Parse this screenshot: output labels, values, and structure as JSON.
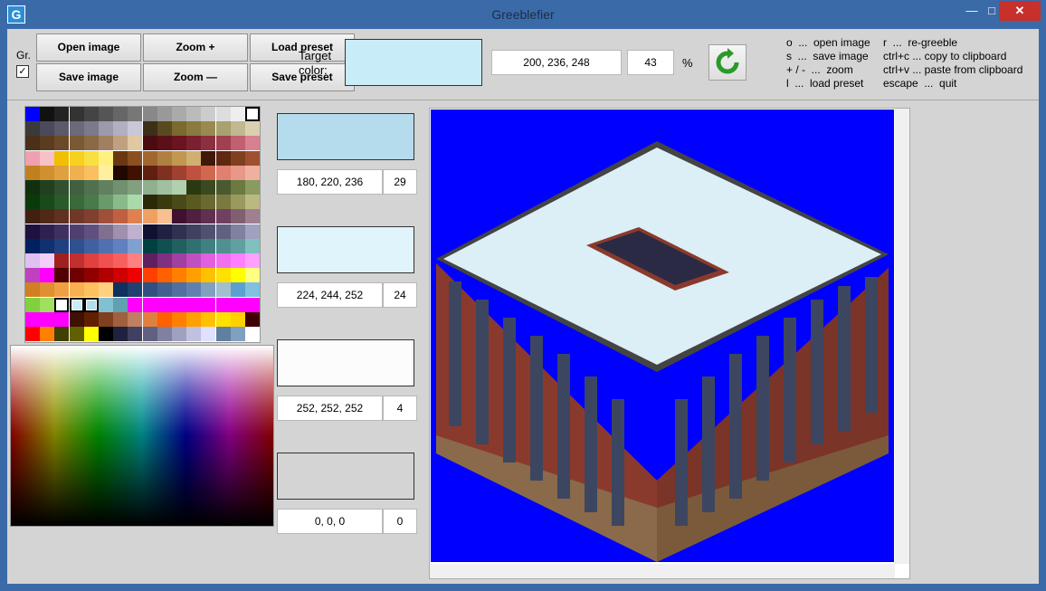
{
  "window": {
    "title": "Greeblefier",
    "icon_letter": "G",
    "minimize": "—",
    "maximize": "□",
    "close": "✕"
  },
  "toolbar": {
    "gr_label": "Gr.",
    "gr_checked": "✓",
    "open_image": "Open image",
    "zoom_in": "Zoom +",
    "load_preset": "Load preset",
    "save_image": "Save image",
    "zoom_out": "Zoom —",
    "save_preset": "Save preset",
    "target_label_line1": "Target",
    "target_label_line2": "color:",
    "target_color_hex": "#c8ecf8",
    "target_rgb": "200, 236, 248",
    "target_percent": "43",
    "percent_sign": "%"
  },
  "shortcuts": {
    "left": "o  ...  open image\ns  ...  save image\n+ / -  ...  zoom\nl  ...  load preset",
    "right": "r  ...  re-greeble\nctrl+c ... copy to clipboard\nctrl+v ... paste from clipboard\nescape  ...  quit"
  },
  "result_colors": [
    {
      "hex": "#b4dcec",
      "rgb": "180, 220, 236",
      "percent": "29"
    },
    {
      "hex": "#e0f4fc",
      "rgb": "224, 244, 252",
      "percent": "24"
    },
    {
      "hex": "#fcfcfc",
      "rgb": "252, 252, 252",
      "percent": "4"
    },
    {
      "hex": "#d4d4d4",
      "rgb": "0, 0, 0",
      "percent": "0"
    }
  ],
  "colors": {
    "titlebar": "#3b6aa8",
    "close_button": "#c7302b",
    "preview_background": "#0000ff"
  }
}
